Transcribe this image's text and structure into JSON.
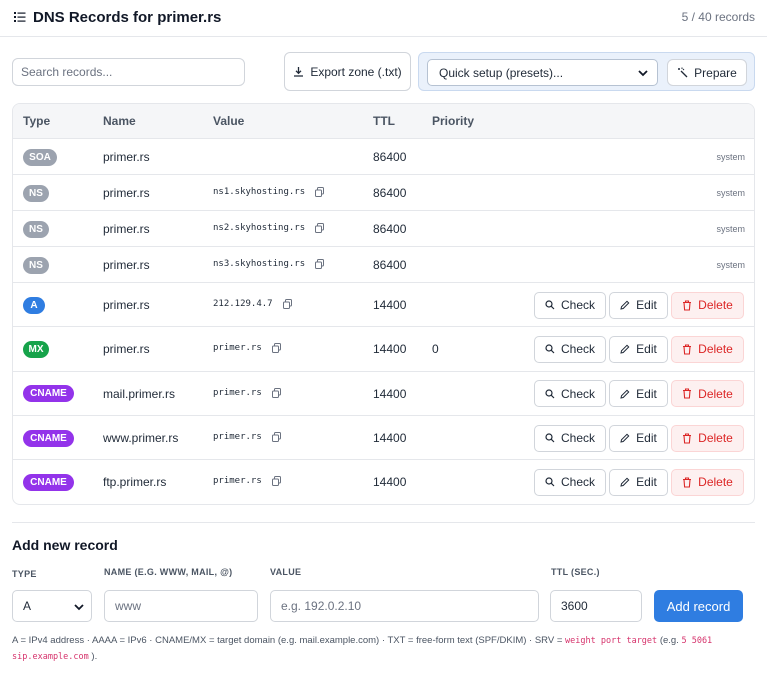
{
  "header": {
    "title": "DNS Records for primer.rs",
    "count": "5 / 40 records"
  },
  "toolbar": {
    "search_placeholder": "Search records...",
    "export_label": "Export zone (.txt)",
    "preset_selected": "Quick setup (presets)...",
    "prepare_label": "Prepare"
  },
  "table": {
    "headers": {
      "type": "Type",
      "name": "Name",
      "value": "Value",
      "ttl": "TTL",
      "priority": "Priority"
    },
    "rows": [
      {
        "type": "SOA",
        "type_color": "#9ca3af",
        "name": "primer.rs",
        "value": "",
        "ttl": "86400",
        "priority": "",
        "system": "system"
      },
      {
        "type": "NS",
        "type_color": "#9ca3af",
        "name": "primer.rs",
        "value": "ns1.skyhosting.rs",
        "ttl": "86400",
        "priority": "",
        "system": "system"
      },
      {
        "type": "NS",
        "type_color": "#9ca3af",
        "name": "primer.rs",
        "value": "ns2.skyhosting.rs",
        "ttl": "86400",
        "priority": "",
        "system": "system"
      },
      {
        "type": "NS",
        "type_color": "#9ca3af",
        "name": "primer.rs",
        "value": "ns3.skyhosting.rs",
        "ttl": "86400",
        "priority": "",
        "system": "system"
      },
      {
        "type": "A",
        "type_color": "#2f7de1",
        "name": "primer.rs",
        "value": "212.129.4.7",
        "ttl": "14400",
        "priority": ""
      },
      {
        "type": "MX",
        "type_color": "#16a34a",
        "name": "primer.rs",
        "value": "primer.rs",
        "ttl": "14400",
        "priority": "0"
      },
      {
        "type": "CNAME",
        "type_color": "#9333ea",
        "name": "mail.primer.rs",
        "value": "primer.rs",
        "ttl": "14400",
        "priority": ""
      },
      {
        "type": "CNAME",
        "type_color": "#9333ea",
        "name": "www.primer.rs",
        "value": "primer.rs",
        "ttl": "14400",
        "priority": ""
      },
      {
        "type": "CNAME",
        "type_color": "#9333ea",
        "name": "ftp.primer.rs",
        "value": "primer.rs",
        "ttl": "14400",
        "priority": ""
      }
    ],
    "actions": {
      "check": "Check",
      "edit": "Edit",
      "delete": "Delete"
    }
  },
  "add_form": {
    "title": "Add new record",
    "type_label": "TYPE",
    "name_label": "NAME (E.G. WWW, MAIL, @)",
    "value_label": "VALUE",
    "ttl_label": "TTL (SEC.)",
    "type_value": "A",
    "name_placeholder": "www",
    "value_placeholder": "e.g. 192.0.2.10",
    "ttl_value": "3600",
    "add_label": "Add record"
  },
  "help": {
    "text": "A = IPv4 address · AAAA = IPv6 · CNAME/MX = target domain (e.g. mail.example.com) · TXT = free-form text (SPF/DKIM) · SRV =",
    "srv_format": "weight port target",
    "eg_open": "(e.g.",
    "srv_example": "5 5061 sip.example.com",
    "eg_close": ")."
  },
  "colors": {
    "accent": "#2f7de1",
    "danger": "#dc2626"
  }
}
